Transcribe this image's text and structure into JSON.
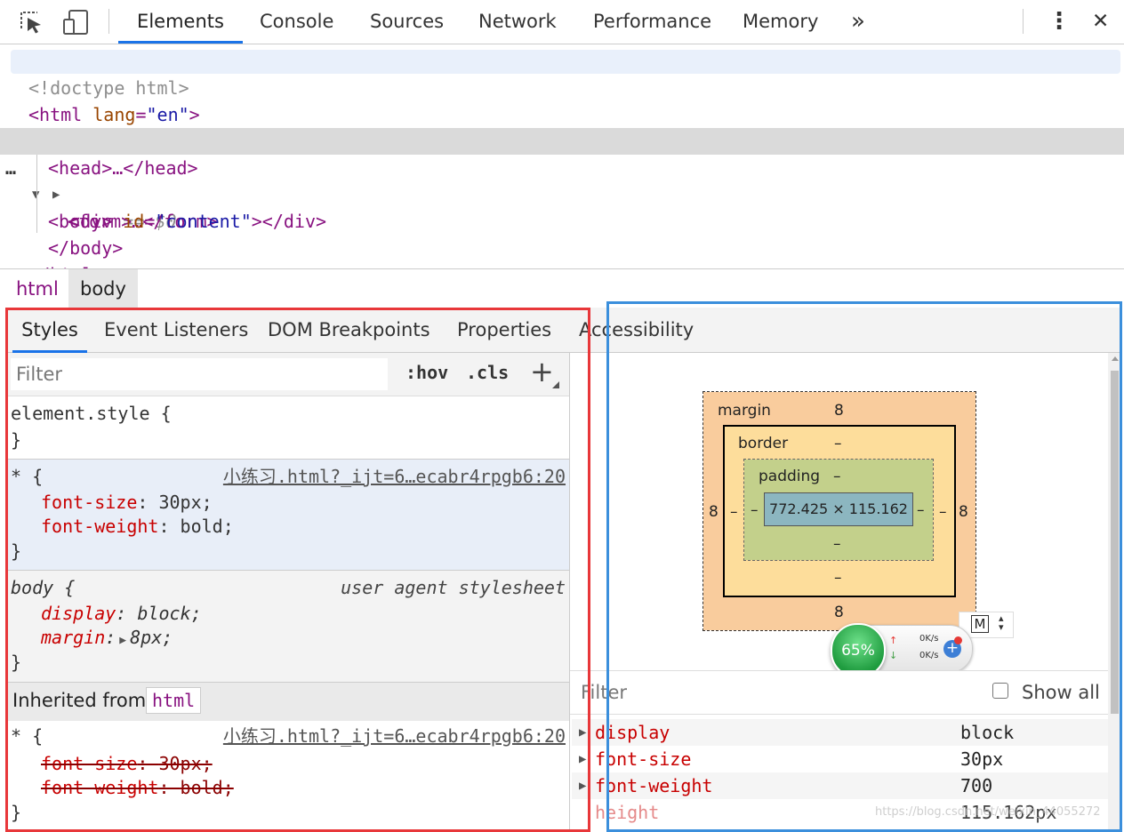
{
  "toolbar": {
    "tabs": [
      {
        "label": "Elements"
      },
      {
        "label": "Console"
      },
      {
        "label": "Sources"
      },
      {
        "label": "Network"
      },
      {
        "label": "Performance"
      },
      {
        "label": "Memory"
      }
    ],
    "more_label": "»",
    "menu_label": "⋮",
    "close_label": "✕"
  },
  "dom": {
    "doctype": "<!doctype html>",
    "html_open_tag": "<html",
    "html_attr": "lang",
    "html_attr_val": "\"en\"",
    "html_close_bracket": ">",
    "head": "<head>…</head>",
    "body_dots": "…",
    "body_open": "<body>",
    "body_eq": " == $0",
    "form": "<form>…</form>",
    "div_open": "<div",
    "div_attr": "id",
    "div_attr_val": "\"content\"",
    "div_end": "></div>",
    "body_close": "</body>",
    "html_close": "</html>"
  },
  "breadcrumb": {
    "items": [
      {
        "label": "html"
      },
      {
        "label": "body"
      }
    ]
  },
  "styles_tabs": [
    {
      "label": "Styles"
    },
    {
      "label": "Event Listeners"
    },
    {
      "label": "DOM Breakpoints"
    },
    {
      "label": "Properties"
    },
    {
      "label": "Accessibility"
    }
  ],
  "styles": {
    "filter_placeholder": "Filter",
    "hov": ":hov",
    "cls": ".cls",
    "plus": "+",
    "element_style": "element.style {",
    "close_brace": "}",
    "rule1": {
      "selector": "* {",
      "source": "小练习.html?_ijt=6…ecabr4rpgb6:20",
      "props": [
        {
          "name": "font-size",
          "value": "30px;"
        },
        {
          "name": "font-weight",
          "value": "bold;"
        }
      ]
    },
    "rule2": {
      "selector": "body {",
      "source": "user agent stylesheet",
      "props": [
        {
          "name": "display",
          "value": "block;"
        },
        {
          "name": "margin",
          "value": "8px;"
        }
      ]
    },
    "inherited_label": "Inherited from",
    "inherited_tag": "html",
    "rule3": {
      "selector": "* {",
      "source": "小练习.html?_ijt=6…ecabr4rpgb6:20",
      "props": [
        {
          "name": "font-size",
          "value": "30px;"
        },
        {
          "name": "font-weight",
          "value": "bold;"
        }
      ]
    }
  },
  "box_model": {
    "margin_label": "margin",
    "margin_top": "8",
    "margin_bottom": "8",
    "margin_left": "8",
    "margin_right": "8",
    "border_label": "border",
    "border_top": "–",
    "border_bottom": "–",
    "border_left": "–",
    "border_right": "–",
    "padding_label": "padding",
    "padding_top": "–",
    "padding_bottom": "–",
    "padding_left": "–",
    "padding_right": "–",
    "content": "772.425 × 115.162",
    "colors": {
      "margin": "#f9cc9d",
      "border": "#fddd9b",
      "padding": "#c3d08b",
      "content": "#8cb6c0"
    }
  },
  "widget": {
    "percent": "65%",
    "up_speed": "0K/s",
    "down_speed": "0K/s",
    "plus": "+",
    "m_label": "M"
  },
  "computed": {
    "filter_placeholder": "Filter",
    "show_all": "Show all",
    "rows": [
      {
        "name": "display",
        "value": "block"
      },
      {
        "name": "font-size",
        "value": "30px"
      },
      {
        "name": "font-weight",
        "value": "700"
      },
      {
        "name": "height",
        "value": "115.162px"
      }
    ]
  },
  "watermark": "https://blog.csdn.net/weixin_44055272",
  "highlight_colors": {
    "left": "#e8373a",
    "right": "#3b8fdc"
  }
}
